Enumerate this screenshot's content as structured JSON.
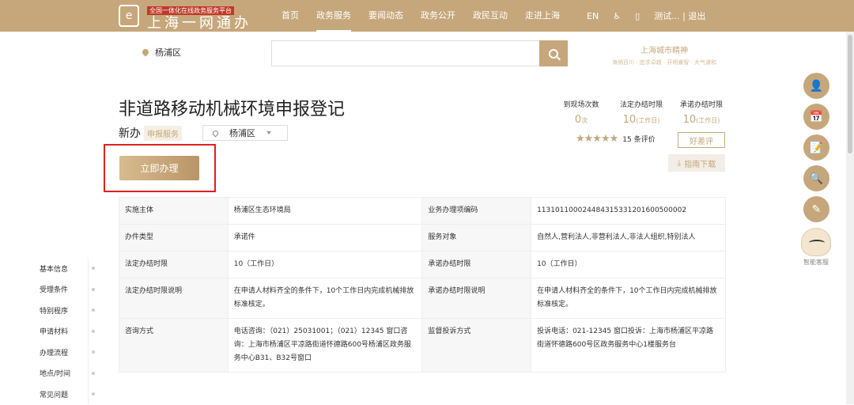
{
  "header": {
    "logo_tag": "全国一体化在线政务服务平台",
    "logo_title": "上海一网通办",
    "nav": [
      "首页",
      "政务服务",
      "要闻动态",
      "政务公开",
      "政民互动",
      "走进上海"
    ],
    "nav_active": "政务服务",
    "lang": "EN",
    "user": "测试... | 退出"
  },
  "search": {
    "district": "杨浦区",
    "placeholder": ""
  },
  "spirit": {
    "title": "上海城市精神",
    "sub": "海纳百川 · 追求卓越 · 开明睿智 · 大气谦和"
  },
  "service": {
    "title": "非道路移动机械环境申报登记",
    "type_label": "新办",
    "tag": "申报服务",
    "district": "杨浦区",
    "apply_button": "立即办理",
    "stats": [
      {
        "label": "到现场次数",
        "value": "0",
        "unit": "次"
      },
      {
        "label": "法定办结时限",
        "value": "10",
        "unit": "(工作日)"
      },
      {
        "label": "承诺办结时限",
        "value": "10",
        "unit": "(工作日)"
      }
    ],
    "stars": "★★★★★",
    "review_count": "15 条评价",
    "review_button": "好差评",
    "guide_button": "指南下载"
  },
  "info_table": [
    {
      "k1": "实施主体",
      "v1": "杨浦区生态环境局",
      "k2": "业务办理项编码",
      "v2": "11310110002448431533120160050000​2"
    },
    {
      "k1": "办件类型",
      "v1": "承诺件",
      "k2": "服务对象",
      "v2": "自然人,营利法人,非营利法人,非法人组织,特别法人"
    },
    {
      "k1": "法定办结时限",
      "v1": "10（工作日）",
      "k2": "承诺办结时限",
      "v2": "10（工作日）"
    },
    {
      "k1": "法定办结时限说明",
      "v1": "在申请人材料齐全的条件下，10个工作日内完成机械排放标准核定。",
      "k2": "承诺办结时限说明",
      "v2": "在申请人材料齐全的条件下，10个工作日内完成机械排放标准核定。"
    },
    {
      "k1": "咨询方式",
      "v1": "电话咨询：（021）25031001；（021）12345 窗口咨询：上海市杨浦区平凉路街道怀德路600号杨浦区政务服务中心B31、B32号窗口",
      "k2": "监督投诉方式",
      "v2": "投诉电话：021-12345 窗口投诉：上海市杨浦区平凉路街道怀德路600号区政务服务中心1楼服务台"
    }
  ],
  "side_nav": [
    "基本信息",
    "受理条件",
    "特别程序",
    "申请材料",
    "办理流程",
    "地点/时间",
    "常见问题"
  ],
  "float_bar": {
    "robot_label": "智能客服"
  }
}
